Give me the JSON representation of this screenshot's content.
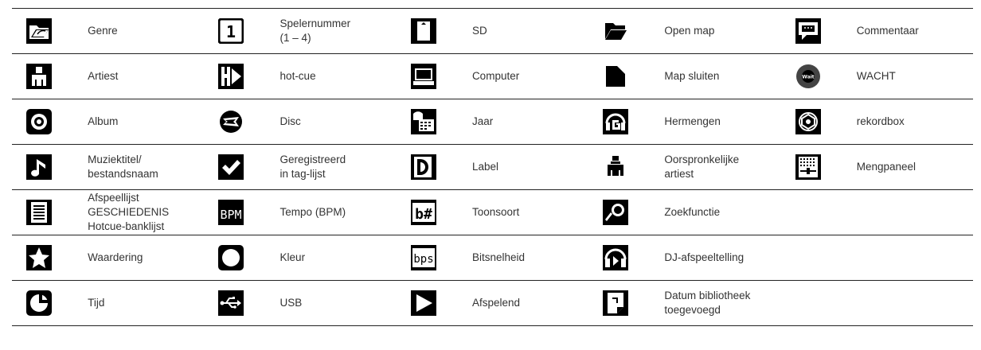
{
  "table": {
    "rows": [
      [
        {
          "icon": "folder-genre-icon",
          "label": "Genre"
        },
        {
          "icon": "player-number-icon",
          "label": "Spelernummer\n(1 – 4)"
        },
        {
          "icon": "sd-card-icon",
          "label": "SD"
        },
        {
          "icon": "open-folder-icon",
          "label": "Open map"
        },
        {
          "icon": "comment-bubble-icon",
          "label": "Commentaar"
        }
      ],
      [
        {
          "icon": "artist-person-icon",
          "label": "Artiest"
        },
        {
          "icon": "hot-cue-icon",
          "label": "hot-cue"
        },
        {
          "icon": "computer-laptop-icon",
          "label": "Computer"
        },
        {
          "icon": "closed-folder-icon",
          "label": "Map sluiten"
        },
        {
          "icon": "wait-disc-icon",
          "label": "WACHT"
        }
      ],
      [
        {
          "icon": "album-disc-icon",
          "label": "Album"
        },
        {
          "icon": "broken-disc-icon",
          "label": "Disc"
        },
        {
          "icon": "calendar-year-icon",
          "label": "Jaar"
        },
        {
          "icon": "remixer-headphones-icon",
          "label": "Hermengen"
        },
        {
          "icon": "rekordbox-logo-icon",
          "label": "rekordbox"
        }
      ],
      [
        {
          "icon": "music-note-icon",
          "label": "Muziektitel/\nbestandsnaam"
        },
        {
          "icon": "checkmark-icon",
          "label": "Geregistreerd\nin tag-lijst"
        },
        {
          "icon": "label-d-icon",
          "label": "Label"
        },
        {
          "icon": "original-artist-icon",
          "label": "Oorspronkelijke\nartiest"
        },
        {
          "icon": "mixer-panel-icon",
          "label": "Mengpaneel"
        }
      ],
      [
        {
          "icon": "playlist-document-icon",
          "label": "Afspeellijst\nGESCHIEDENIS\nHotcue-banklijst"
        },
        {
          "icon": "bpm-text-icon",
          "label": "Tempo (BPM)"
        },
        {
          "icon": "key-sharp-icon",
          "label": "Toonsoort"
        },
        {
          "icon": "search-magnifier-icon",
          "label": "Zoekfunctie"
        },
        null
      ],
      [
        {
          "icon": "star-rating-icon",
          "label": "Waardering"
        },
        {
          "icon": "color-circle-icon",
          "label": "Kleur"
        },
        {
          "icon": "bps-text-icon",
          "label": "Bitsnelheid"
        },
        {
          "icon": "dj-play-count-icon",
          "label": "DJ-afspeeltelling"
        },
        null
      ],
      [
        {
          "icon": "time-clock-icon",
          "label": "Tijd"
        },
        {
          "icon": "usb-icon",
          "label": "USB"
        },
        {
          "icon": "play-triangle-icon",
          "label": "Afspelend"
        },
        {
          "icon": "date-added-icon",
          "label": "Datum bibliotheek toegevoegd"
        },
        null
      ]
    ],
    "icon_text": {
      "player-number-icon": "1",
      "bpm-text-icon": "BPM",
      "key-sharp-icon": "b#",
      "bps-text-icon": "bps",
      "wait-disc-icon": "Wait"
    },
    "colors": {
      "icon_bg": "#000000",
      "icon_fg": "#ffffff",
      "rule": "#222222",
      "text": "#333333"
    }
  }
}
